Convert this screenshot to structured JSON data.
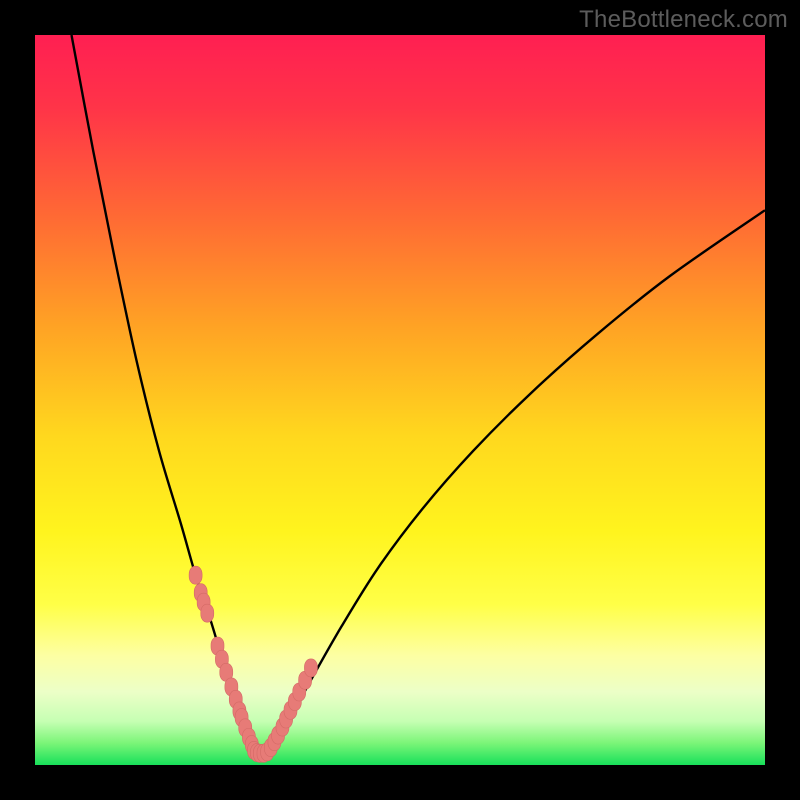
{
  "watermark_text": "TheBottleneck.com",
  "colors": {
    "frame": "#000000",
    "watermark": "#5c5c5c",
    "curve": "#000000",
    "dot_fill": "#e77b77",
    "dot_stroke": "#d46a66"
  },
  "gradient_stops": [
    {
      "offset": 0.0,
      "color": "#ff1f52"
    },
    {
      "offset": 0.1,
      "color": "#ff3448"
    },
    {
      "offset": 0.25,
      "color": "#ff6a34"
    },
    {
      "offset": 0.4,
      "color": "#ffa324"
    },
    {
      "offset": 0.55,
      "color": "#ffd81e"
    },
    {
      "offset": 0.68,
      "color": "#fff41e"
    },
    {
      "offset": 0.78,
      "color": "#ffff47"
    },
    {
      "offset": 0.85,
      "color": "#fdffa3"
    },
    {
      "offset": 0.9,
      "color": "#ecffc7"
    },
    {
      "offset": 0.94,
      "color": "#c6ffb3"
    },
    {
      "offset": 0.97,
      "color": "#7bf578"
    },
    {
      "offset": 1.0,
      "color": "#18e05a"
    }
  ],
  "chart_data": {
    "type": "line",
    "title": "",
    "xlabel": "",
    "ylabel": "",
    "xlim": [
      0,
      100
    ],
    "ylim": [
      0,
      100
    ],
    "grid": false,
    "series": [
      {
        "name": "bottleneck-curve",
        "x": [
          5,
          8,
          11,
          14,
          17,
          20,
          22,
          24,
          25.5,
          27,
          28,
          29,
          30,
          31.5,
          33,
          35,
          38,
          42,
          47,
          53,
          60,
          68,
          77,
          87,
          100
        ],
        "values": [
          100,
          84,
          69,
          55,
          43,
          33,
          26,
          20,
          15,
          10,
          6,
          3,
          1.5,
          1.5,
          3,
          6.5,
          12,
          19,
          27,
          35,
          43,
          51,
          59,
          67,
          76
        ]
      },
      {
        "name": "highlight-dots",
        "x": [
          22.0,
          22.7,
          23.1,
          23.6,
          25.0,
          25.6,
          26.2,
          26.9,
          27.5,
          28.0,
          28.3,
          28.8,
          29.3,
          29.7,
          30.0,
          30.4,
          30.8,
          31.3,
          31.8,
          32.3,
          32.8,
          33.3,
          33.9,
          34.4,
          35.0,
          35.6,
          36.2,
          37.0,
          37.8
        ],
        "values": [
          26.0,
          23.6,
          22.3,
          20.8,
          16.3,
          14.5,
          12.7,
          10.7,
          9.0,
          7.4,
          6.5,
          5.1,
          3.8,
          2.8,
          2.0,
          1.7,
          1.6,
          1.6,
          1.8,
          2.4,
          3.2,
          4.1,
          5.2,
          6.3,
          7.5,
          8.7,
          10.0,
          11.6,
          13.3
        ]
      }
    ]
  }
}
